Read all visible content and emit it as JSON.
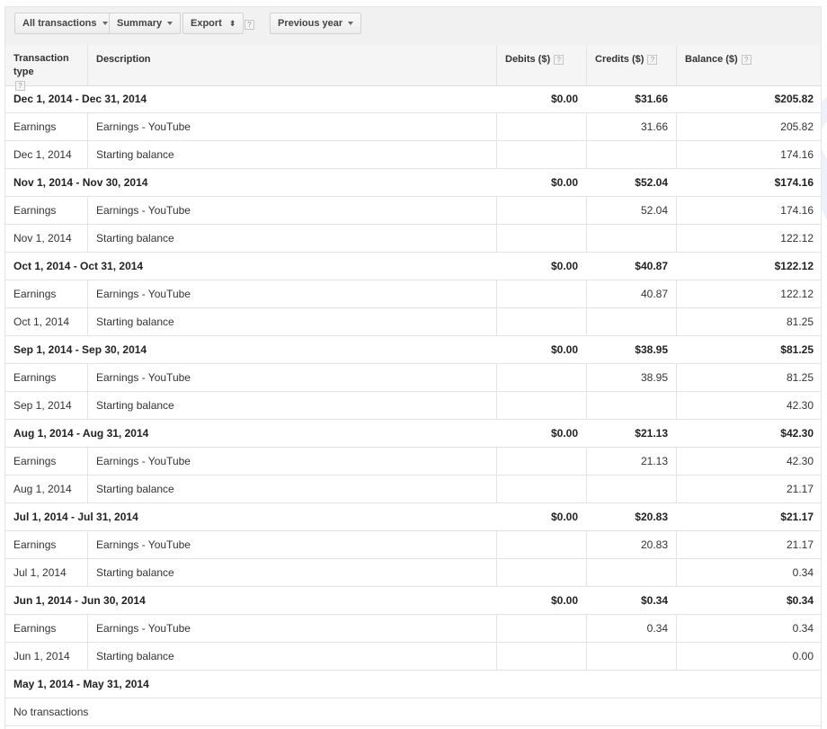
{
  "toolbar": {
    "filter_label": "All transactions",
    "view_label": "Summary",
    "export_label": "Export",
    "help_mark": "?",
    "range_label": "Previous year"
  },
  "columns": {
    "type": "Transaction type",
    "description": "Description",
    "debits": "Debits ($)",
    "credits": "Credits ($)",
    "balance": "Balance ($)",
    "help_mark": "?"
  },
  "periods": [
    {
      "label": "Dec 1, 2014 - Dec 31, 2014",
      "debits": "$0.00",
      "credits": "$31.66",
      "balance": "$205.82",
      "rows": [
        {
          "type": "Earnings",
          "description": "Earnings - YouTube",
          "credit": "31.66",
          "balance": "205.82"
        },
        {
          "type": "Dec 1, 2014",
          "description": "Starting balance",
          "credit": "",
          "balance": "174.16"
        }
      ]
    },
    {
      "label": "Nov 1, 2014 - Nov 30, 2014",
      "debits": "$0.00",
      "credits": "$52.04",
      "balance": "$174.16",
      "rows": [
        {
          "type": "Earnings",
          "description": "Earnings - YouTube",
          "credit": "52.04",
          "balance": "174.16"
        },
        {
          "type": "Nov 1, 2014",
          "description": "Starting balance",
          "credit": "",
          "balance": "122.12"
        }
      ]
    },
    {
      "label": "Oct 1, 2014 - Oct 31, 2014",
      "debits": "$0.00",
      "credits": "$40.87",
      "balance": "$122.12",
      "rows": [
        {
          "type": "Earnings",
          "description": "Earnings - YouTube",
          "credit": "40.87",
          "balance": "122.12"
        },
        {
          "type": "Oct 1, 2014",
          "description": "Starting balance",
          "credit": "",
          "balance": "81.25"
        }
      ]
    },
    {
      "label": "Sep 1, 2014 - Sep 30, 2014",
      "debits": "$0.00",
      "credits": "$38.95",
      "balance": "$81.25",
      "rows": [
        {
          "type": "Earnings",
          "description": "Earnings - YouTube",
          "credit": "38.95",
          "balance": "81.25"
        },
        {
          "type": "Sep 1, 2014",
          "description": "Starting balance",
          "credit": "",
          "balance": "42.30"
        }
      ]
    },
    {
      "label": "Aug 1, 2014 - Aug 31, 2014",
      "debits": "$0.00",
      "credits": "$21.13",
      "balance": "$42.30",
      "rows": [
        {
          "type": "Earnings",
          "description": "Earnings - YouTube",
          "credit": "21.13",
          "balance": "42.30"
        },
        {
          "type": "Aug 1, 2014",
          "description": "Starting balance",
          "credit": "",
          "balance": "21.17"
        }
      ]
    },
    {
      "label": "Jul 1, 2014 - Jul 31, 2014",
      "debits": "$0.00",
      "credits": "$20.83",
      "balance": "$21.17",
      "rows": [
        {
          "type": "Earnings",
          "description": "Earnings - YouTube",
          "credit": "20.83",
          "balance": "21.17"
        },
        {
          "type": "Jul 1, 2014",
          "description": "Starting balance",
          "credit": "",
          "balance": "0.34"
        }
      ]
    },
    {
      "label": "Jun 1, 2014 - Jun 30, 2014",
      "debits": "$0.00",
      "credits": "$0.34",
      "balance": "$0.34",
      "rows": [
        {
          "type": "Earnings",
          "description": "Earnings - YouTube",
          "credit": "0.34",
          "balance": "0.34"
        },
        {
          "type": "Jun 1, 2014",
          "description": "Starting balance",
          "credit": "",
          "balance": "0.00"
        }
      ]
    },
    {
      "label": "May 1, 2014 - May 31, 2014",
      "debits": "",
      "credits": "",
      "balance": "",
      "rows": [],
      "empty_note": "No transactions"
    }
  ],
  "watermark": "pavielin",
  "colors": {
    "toolbar_bg": "#f1f1f1",
    "header_bg": "#f5f5f5",
    "border": "#e3e3e3",
    "text": "#333333",
    "watermark": "#eef0fb"
  }
}
